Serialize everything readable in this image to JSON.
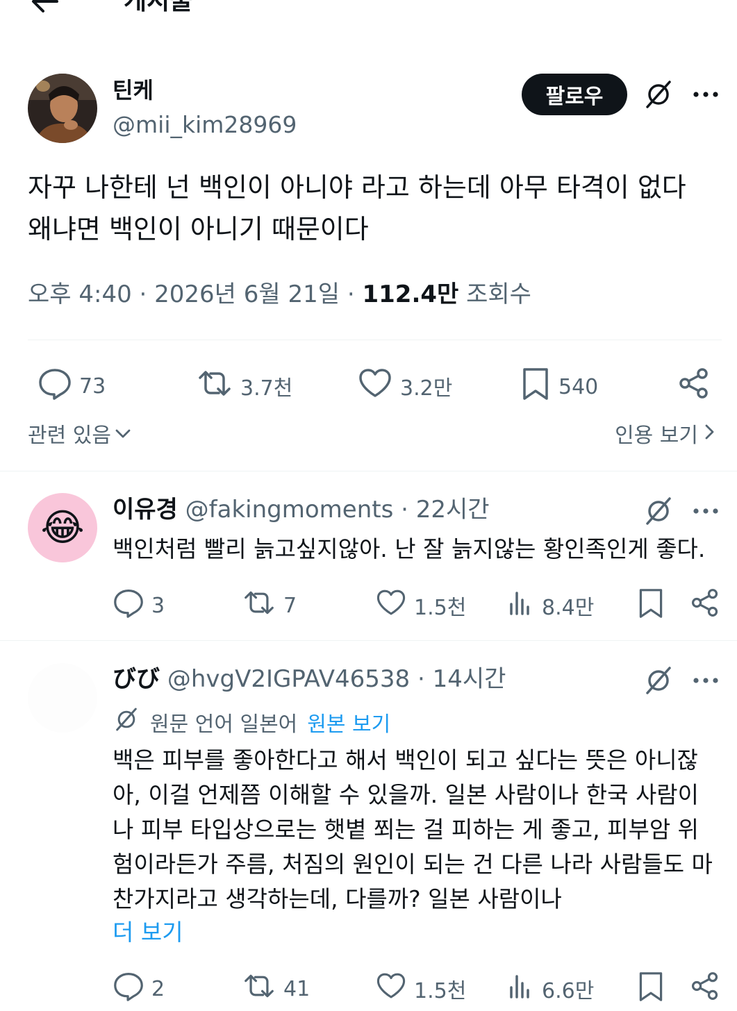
{
  "header": {
    "title": "게시물",
    "back_icon": "arrow-left-icon"
  },
  "post": {
    "author": {
      "name": "틴케",
      "handle": "@mii_kim28969"
    },
    "follow_label": "팔로우",
    "text": "자꾸 나한테 넌 백인이 아니야 라고 하는데 아무 타격이 없다\n왜냐면 백인이 아니기 때문이다",
    "time": "오후 4:40",
    "date": "2026년 6월 21일",
    "views_count": "112.4만",
    "views_label": "조회수",
    "stats": {
      "replies": "73",
      "reposts": "3.7천",
      "likes": "3.2만",
      "bookmarks": "540"
    },
    "related_label": "관련 있음",
    "quotes_label": "인용 보기"
  },
  "replies": [
    {
      "name": "이유경",
      "handle": "@fakingmoments",
      "time": "22시간",
      "avatar_emoji": "😂",
      "text": "백인처럼 빨리 늙고싶지않아. 난 잘 늙지않는 황인족인게 좋다.",
      "stats": {
        "replies": "3",
        "reposts": "7",
        "likes": "1.5천",
        "views": "8.4만"
      }
    },
    {
      "name": "びび",
      "handle": "@hvgV2IGPAV46538",
      "time": "14시간",
      "translate_note": "원문 언어 일본어",
      "translate_link": "원본 보기",
      "text_lines": [
        "백은 피부를 좋아한다고 해서 백인이 되고 싶다는 뜻은 아니잖",
        "아, 이걸 언제쯤 이해할 수 있을까. 일본 사람이나 한국 사람이",
        "나 피부 타입상으로는 햇볕 쬐는 걸 피하는 게 좋고, 피부암 위",
        "험이라든가 주름, 처짐의 원인이 되는 건 다른 나라 사람들도 마",
        "찬가지라고 생각하는데, 다를까? 일본 사람이나"
      ],
      "show_more": "더 보기",
      "stats": {
        "replies": "2",
        "reposts": "41",
        "likes": "1.5천",
        "views": "6.6만"
      }
    }
  ],
  "colors": {
    "text": "#0f1419",
    "secondary": "#536471",
    "link": "#1d9bf0",
    "divider": "#eff3f4"
  }
}
